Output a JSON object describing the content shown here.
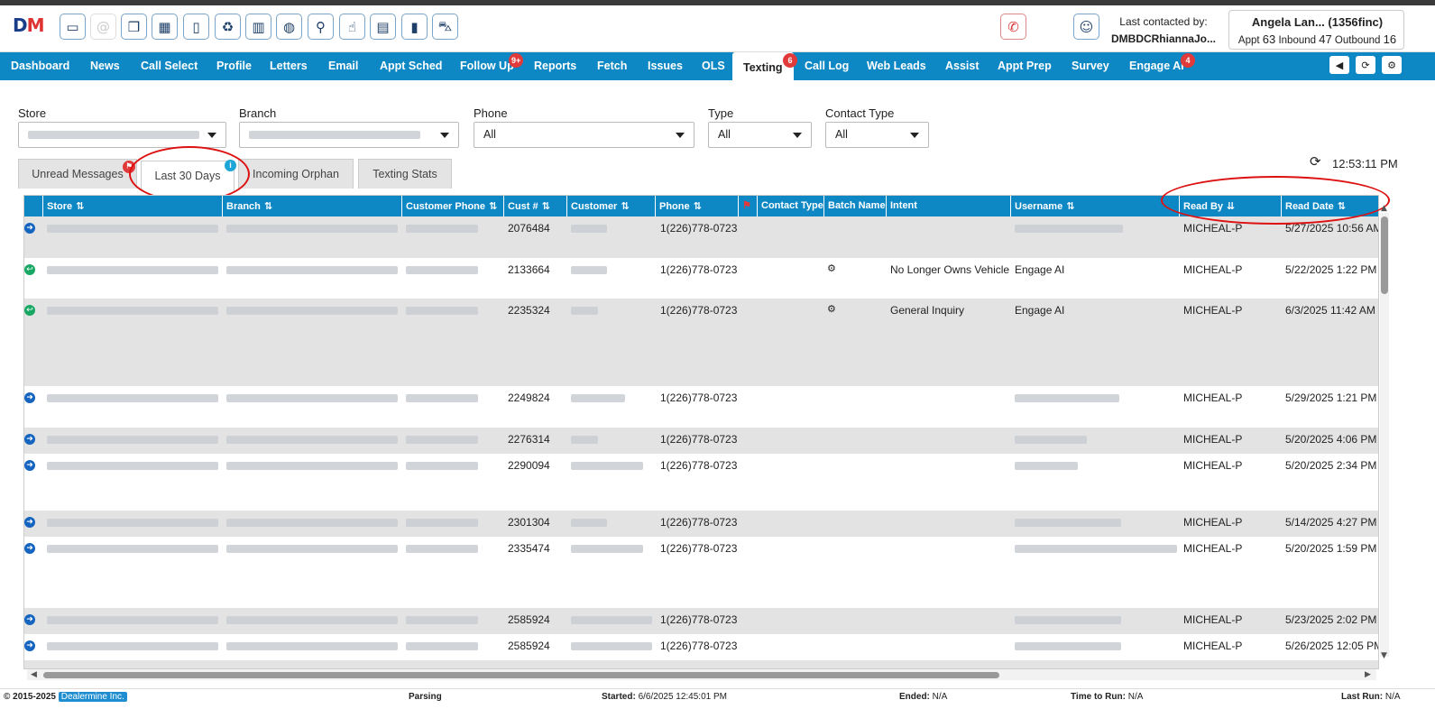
{
  "app": {
    "logo_text": "DM"
  },
  "toolbar": {
    "icons": [
      "desktop-phone-icon",
      "at-sign-icon",
      "note-icon",
      "calendar-plus-icon",
      "clipboard-icon",
      "recycle-icon",
      "trash-icon",
      "palette-icon",
      "search-icon",
      "hand-pointer-icon",
      "chat-icon",
      "bookmark-icon",
      "car-icon"
    ]
  },
  "contact": {
    "last_label": "Last contacted by:",
    "last_value": "DMBDCRhiannaJo...",
    "name": "Angela Lan... (1356finc)",
    "appt_label": "Appt",
    "appt": "63",
    "inbound_label": "Inbound",
    "inbound": "47",
    "outbound_label": "Outbound",
    "outbound": "16"
  },
  "nav": {
    "items": [
      "Dashboard",
      "News",
      "Call Select",
      "Profile",
      "Letters",
      "Email",
      "Appt Sched",
      "Follow Up",
      "Reports",
      "Fetch",
      "Issues",
      "OLS",
      "Texting",
      "Call Log",
      "Web Leads",
      "Assist",
      "Appt Prep",
      "Survey",
      "Engage AI"
    ],
    "active": "Texting",
    "followup_badge": "9+",
    "texting_badge": "6",
    "engage_badge": "4"
  },
  "filters": {
    "store_label": "Store",
    "branch_label": "Branch",
    "phone_label": "Phone",
    "phone_value": "All",
    "type_label": "Type",
    "type_value": "All",
    "contact_type_label": "Contact Type",
    "contact_type_value": "All"
  },
  "tabs": [
    "Unread Messages",
    "Last 30 Days",
    "Incoming Orphan",
    "Texting Stats"
  ],
  "clock": "12:53:11 PM",
  "grid": {
    "headers": [
      "Store",
      "Branch",
      "Customer Phone",
      "Cust #",
      "Customer",
      "Phone",
      "Contact Type",
      "Batch Name",
      "Intent",
      "Username",
      "Read By",
      "Read Date"
    ],
    "rows": [
      {
        "dir": "out",
        "cust": "2076484",
        "phone": "1(226)778-0723",
        "batch": "",
        "intent": "",
        "user": "",
        "read_by": "MICHEAL-P",
        "read_date": "5/27/2025 10:56 AM"
      },
      {
        "dir": "in",
        "cust": "2133664",
        "phone": "1(226)778-0723",
        "batch": "bot",
        "intent": "No Longer Owns Vehicle",
        "user": "Engage AI",
        "read_by": "MICHEAL-P",
        "read_date": "5/22/2025 1:22 PM"
      },
      {
        "dir": "in",
        "cust": "2235324",
        "phone": "1(226)778-0723",
        "batch": "bot",
        "intent": "General Inquiry",
        "user": "Engage AI",
        "read_by": "MICHEAL-P",
        "read_date": "6/3/2025 11:42 AM"
      },
      {
        "dir": "out",
        "cust": "2249824",
        "phone": "1(226)778-0723",
        "batch": "",
        "intent": "",
        "user": "",
        "read_by": "MICHEAL-P",
        "read_date": "5/29/2025 1:21 PM"
      },
      {
        "dir": "out",
        "cust": "2276314",
        "phone": "1(226)778-0723",
        "batch": "",
        "intent": "",
        "user": "",
        "read_by": "MICHEAL-P",
        "read_date": "5/20/2025 4:06 PM"
      },
      {
        "dir": "out",
        "cust": "2290094",
        "phone": "1(226)778-0723",
        "batch": "",
        "intent": "",
        "user": "",
        "read_by": "MICHEAL-P",
        "read_date": "5/20/2025 2:34 PM"
      },
      {
        "dir": "out",
        "cust": "2301304",
        "phone": "1(226)778-0723",
        "batch": "",
        "intent": "",
        "user": "",
        "read_by": "MICHEAL-P",
        "read_date": "5/14/2025 4:27 PM"
      },
      {
        "dir": "out",
        "cust": "2335474",
        "phone": "1(226)778-0723",
        "batch": "",
        "intent": "",
        "user": "",
        "read_by": "MICHEAL-P",
        "read_date": "5/20/2025 1:59 PM"
      },
      {
        "dir": "out",
        "cust": "2585924",
        "phone": "1(226)778-0723",
        "batch": "",
        "intent": "",
        "user": "",
        "read_by": "MICHEAL-P",
        "read_date": "5/23/2025 2:02 PM"
      },
      {
        "dir": "out",
        "cust": "2585924",
        "phone": "1(226)778-0723",
        "batch": "",
        "intent": "",
        "user": "",
        "read_by": "MICHEAL-P",
        "read_date": "5/26/2025 12:05 PM"
      }
    ]
  },
  "status": {
    "copyright": "© 2015-2025",
    "company": "Dealermine Inc.",
    "state": "Parsing",
    "started_label": "Started:",
    "started": "6/6/2025 12:45:01 PM",
    "ended_label": "Ended:",
    "ended": "N/A",
    "ttr_label": "Time to Run:",
    "ttr": "N/A",
    "lastrun_label": "Last Run:",
    "lastrun": "N/A"
  },
  "colors": {
    "nav_blue": "#0e88c4",
    "badge_red": "#e03a3a",
    "annotation_red": "#d11"
  }
}
